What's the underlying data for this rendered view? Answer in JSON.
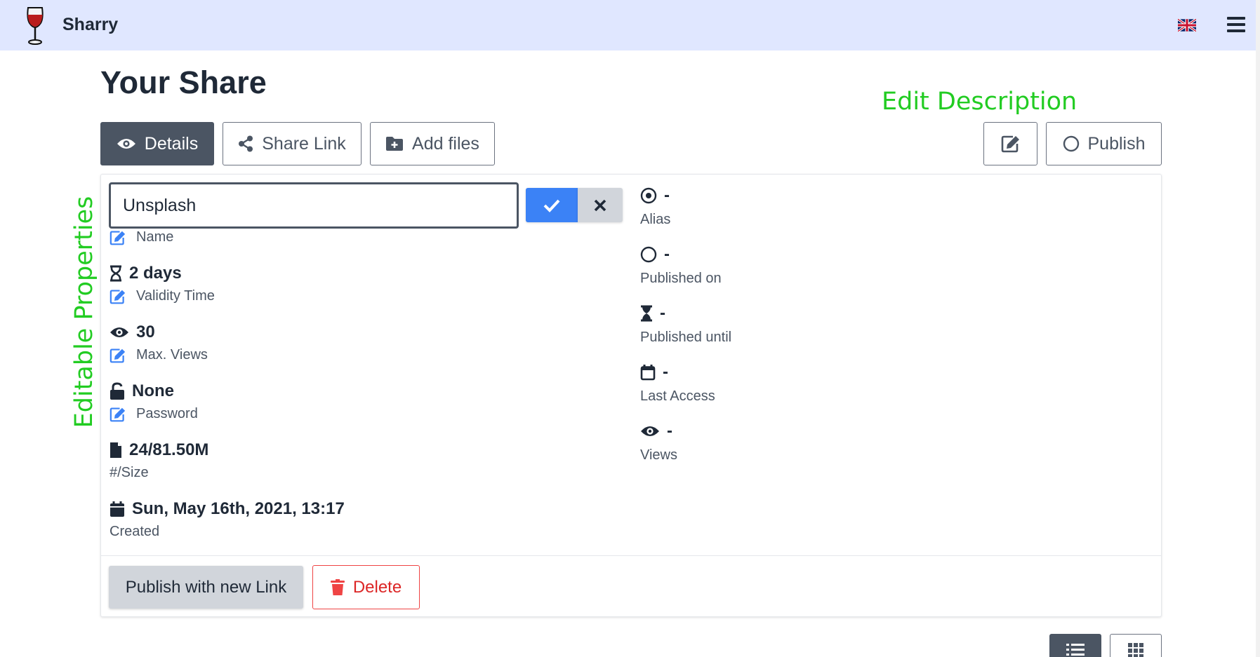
{
  "app": {
    "title": "Sharry"
  },
  "page": {
    "title": "Your Share"
  },
  "annotations": {
    "top": "Edit Description",
    "side": "Editable Properties"
  },
  "tabs": [
    {
      "label": "Details",
      "icon": "eye-icon",
      "active": true
    },
    {
      "label": "Share Link",
      "icon": "share-icon",
      "active": false
    },
    {
      "label": "Add files",
      "icon": "folder-plus-icon",
      "active": false
    }
  ],
  "actions": {
    "publish_label": "Publish"
  },
  "name_editor": {
    "value": "Unsplash"
  },
  "left_props": [
    {
      "value": "",
      "label": "Name"
    },
    {
      "value": "2 days",
      "label": "Validity Time"
    },
    {
      "value": "30",
      "label": "Max. Views"
    },
    {
      "value": "None",
      "label": "Password"
    },
    {
      "value": "24/81.50M",
      "label": "#/Size"
    },
    {
      "value": "Sun, May 16th, 2021, 13:17",
      "label": "Created"
    }
  ],
  "right_props": [
    {
      "value": "-",
      "label": "Alias"
    },
    {
      "value": "-",
      "label": "Published on"
    },
    {
      "value": "-",
      "label": "Published until"
    },
    {
      "value": "-",
      "label": "Last Access"
    },
    {
      "value": "-",
      "label": "Views"
    }
  ],
  "footer": {
    "publish_new_label": "Publish with new Link",
    "delete_label": "Delete"
  },
  "colors": {
    "accent": "#3b82f6",
    "danger": "#ef4444",
    "annotation": "#22cc22",
    "topbar": "#e0e7ff",
    "dark": "#4b5563"
  }
}
